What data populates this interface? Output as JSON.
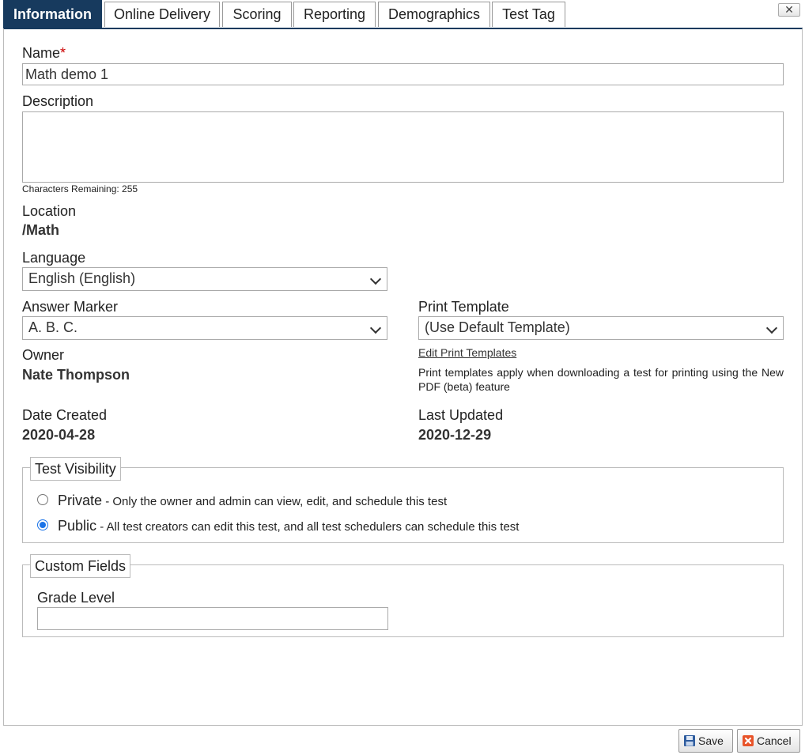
{
  "tabs": [
    {
      "label": "Information",
      "active": true
    },
    {
      "label": "Online Delivery"
    },
    {
      "label": "Scoring"
    },
    {
      "label": "Reporting"
    },
    {
      "label": "Demographics"
    },
    {
      "label": "Test Tag"
    }
  ],
  "close_symbol": "✕",
  "form": {
    "name_label": "Name",
    "name_required_mark": "*",
    "name_value": "Math demo 1",
    "description_label": "Description",
    "description_value": "",
    "chars_remaining": "Characters Remaining: 255",
    "location_label": "Location",
    "location_value": "/Math",
    "language_label": "Language",
    "language_value": "English (English)",
    "answer_marker_label": "Answer Marker",
    "answer_marker_value": "A. B. C.",
    "print_template_label": "Print Template",
    "print_template_value": "(Use Default Template)",
    "edit_print_templates_link": "Edit Print Templates",
    "print_template_note": "Print templates apply when downloading a test for printing using the New PDF (beta) feature",
    "owner_label": "Owner",
    "owner_value": "Nate Thompson",
    "date_created_label": "Date Created",
    "date_created_value": "2020-04-28",
    "last_updated_label": "Last Updated",
    "last_updated_value": "2020-12-29"
  },
  "visibility": {
    "legend": "Test Visibility",
    "options": [
      {
        "label": "Private",
        "desc": " - Only the owner and admin can view, edit, and schedule this test",
        "selected": false
      },
      {
        "label": "Public",
        "desc": " - All test creators can edit this test, and all test schedulers can schedule this test",
        "selected": true
      }
    ]
  },
  "custom_fields": {
    "legend": "Custom Fields",
    "grade_level_label": "Grade Level",
    "grade_level_value": ""
  },
  "buttons": {
    "save_label": "Save",
    "cancel_label": "Cancel"
  },
  "icons": {
    "save": "floppy-disk-icon",
    "cancel": "x-cancel-icon"
  },
  "colors": {
    "active_tab": "#173a5e",
    "required": "#cc0000",
    "radio_selected": "#1a73e8"
  }
}
